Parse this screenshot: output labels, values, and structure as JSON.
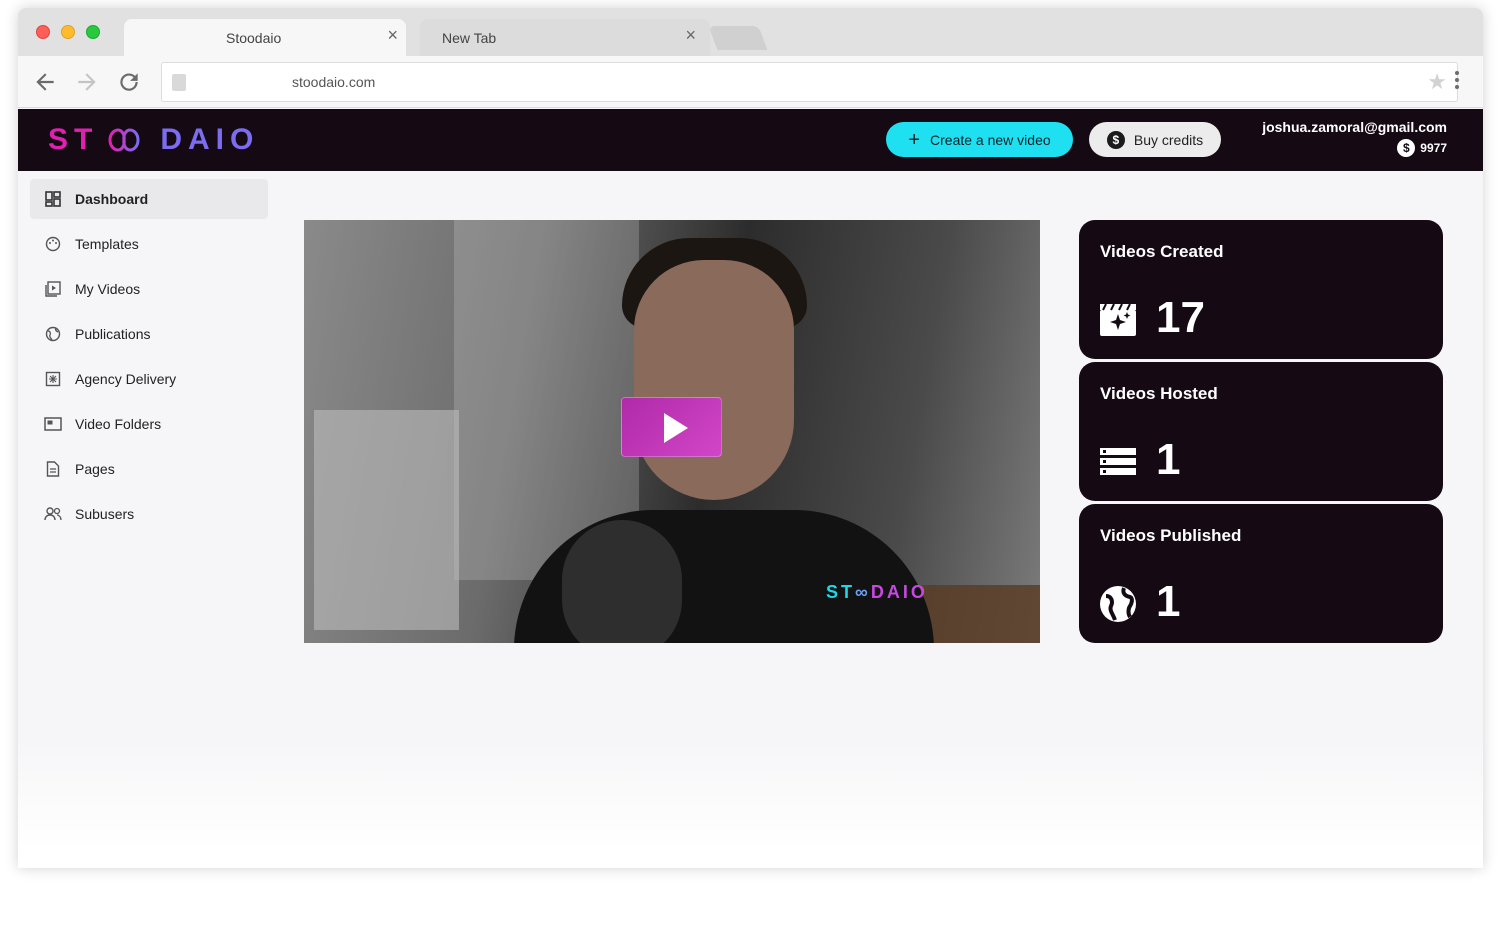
{
  "browser": {
    "tabs": [
      {
        "title": "Stoodaio",
        "close": "×"
      },
      {
        "title": "New Tab",
        "close": "×"
      }
    ],
    "url": "stoodaio.com"
  },
  "header": {
    "logo_text_left": "ST",
    "logo_text_right": "DAIO",
    "create_button": "Create a new video",
    "create_icon": "+",
    "credits_button": "Buy credits",
    "credits_icon": "$",
    "user_email": "joshua.zamoral@gmail.com",
    "user_credits": "9977"
  },
  "sidebar": {
    "items": [
      {
        "label": "Dashboard",
        "icon": "dashboard-icon",
        "active": true
      },
      {
        "label": "Templates",
        "icon": "palette-icon",
        "active": false
      },
      {
        "label": "My Videos",
        "icon": "video-library-icon",
        "active": false
      },
      {
        "label": "Publications",
        "icon": "globe-icon",
        "active": false
      },
      {
        "label": "Agency Delivery",
        "icon": "package-icon",
        "active": false
      },
      {
        "label": "Video Folders",
        "icon": "folder-icon",
        "active": false
      },
      {
        "label": "Pages",
        "icon": "page-icon",
        "active": false
      },
      {
        "label": "Subusers",
        "icon": "users-icon",
        "active": false
      }
    ]
  },
  "video": {
    "watermark_left": "ST",
    "watermark_right": "DAIO"
  },
  "stats": [
    {
      "title": "Videos Created",
      "value": "17",
      "icon": "clapperboard-sparkle-icon"
    },
    {
      "title": "Videos Hosted",
      "value": "1",
      "icon": "server-list-icon"
    },
    {
      "title": "Videos Published",
      "value": "1",
      "icon": "globe-icon"
    }
  ],
  "colors": {
    "appbar": "#150a14",
    "accent_cyan": "#1ee0f0",
    "accent_magenta": "#e020b0"
  }
}
